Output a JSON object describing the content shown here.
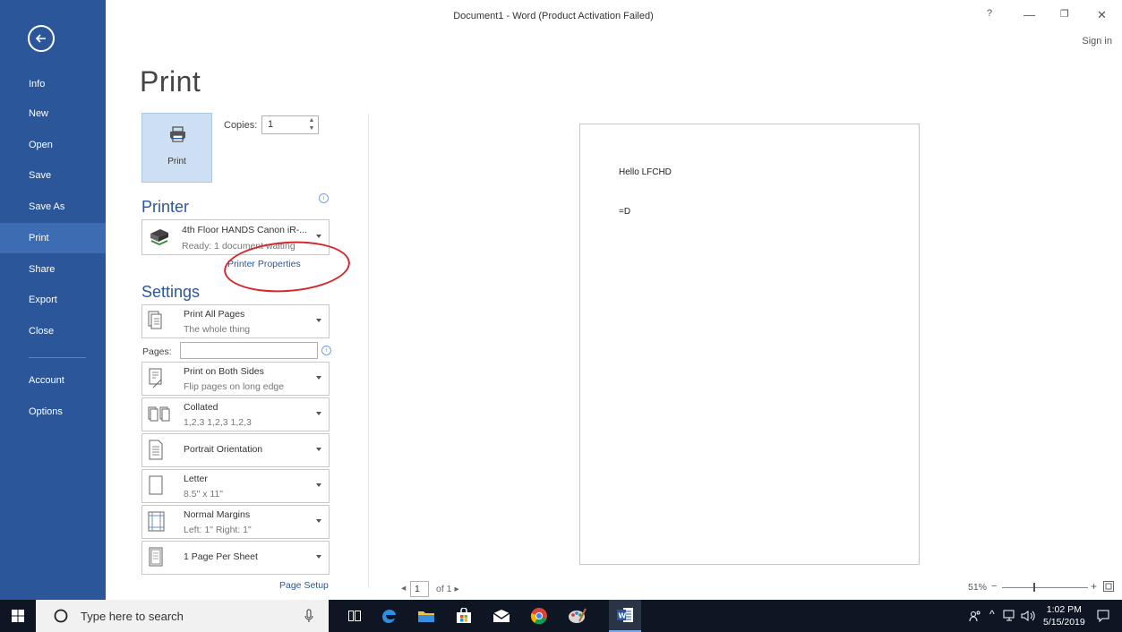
{
  "window": {
    "title": "Document1 - Word (Product Activation Failed)",
    "sign_in": "Sign in",
    "help": "?",
    "minimize": "—",
    "restore": "❐",
    "close": "✕"
  },
  "nav": {
    "items": [
      {
        "label": "Info"
      },
      {
        "label": "New"
      },
      {
        "label": "Open"
      },
      {
        "label": "Save"
      },
      {
        "label": "Save As"
      },
      {
        "label": "Print"
      },
      {
        "label": "Share"
      },
      {
        "label": "Export"
      },
      {
        "label": "Close"
      },
      {
        "label": "Account"
      },
      {
        "label": "Options"
      }
    ],
    "active": "Print"
  },
  "print": {
    "heading": "Print",
    "button_label": "Print",
    "copies_label": "Copies:",
    "copies_value": "1"
  },
  "printer": {
    "heading": "Printer",
    "name": "4th Floor HANDS Canon iR-...",
    "status": "Ready: 1 document waiting",
    "properties_link": "Printer Properties"
  },
  "settings": {
    "heading": "Settings",
    "pages_label": "Pages:",
    "pages_value": "",
    "options": [
      {
        "line1": "Print All Pages",
        "line2": "The whole thing"
      },
      {
        "line1": "Print on Both Sides",
        "line2": "Flip pages on long edge"
      },
      {
        "line1": "Collated",
        "line2": "1,2,3   1,2,3   1,2,3"
      },
      {
        "line1": "Portrait Orientation",
        "line2": ""
      },
      {
        "line1": "Letter",
        "line2": "8.5\" x 11\""
      },
      {
        "line1": "Normal Margins",
        "line2": "Left:  1\"   Right:  1\""
      },
      {
        "line1": "1 Page Per Sheet",
        "line2": ""
      }
    ],
    "page_setup_link": "Page Setup"
  },
  "preview": {
    "lines": [
      "Hello LFCHD",
      "=D"
    ],
    "current_page": "1",
    "of_pages": "of 1",
    "zoom": "51%"
  },
  "taskbar": {
    "search_placeholder": "Type here to search",
    "time": "1:02 PM",
    "date": "5/15/2019"
  },
  "colors": {
    "accent": "#2b579a",
    "annotation": "#d4282c"
  }
}
